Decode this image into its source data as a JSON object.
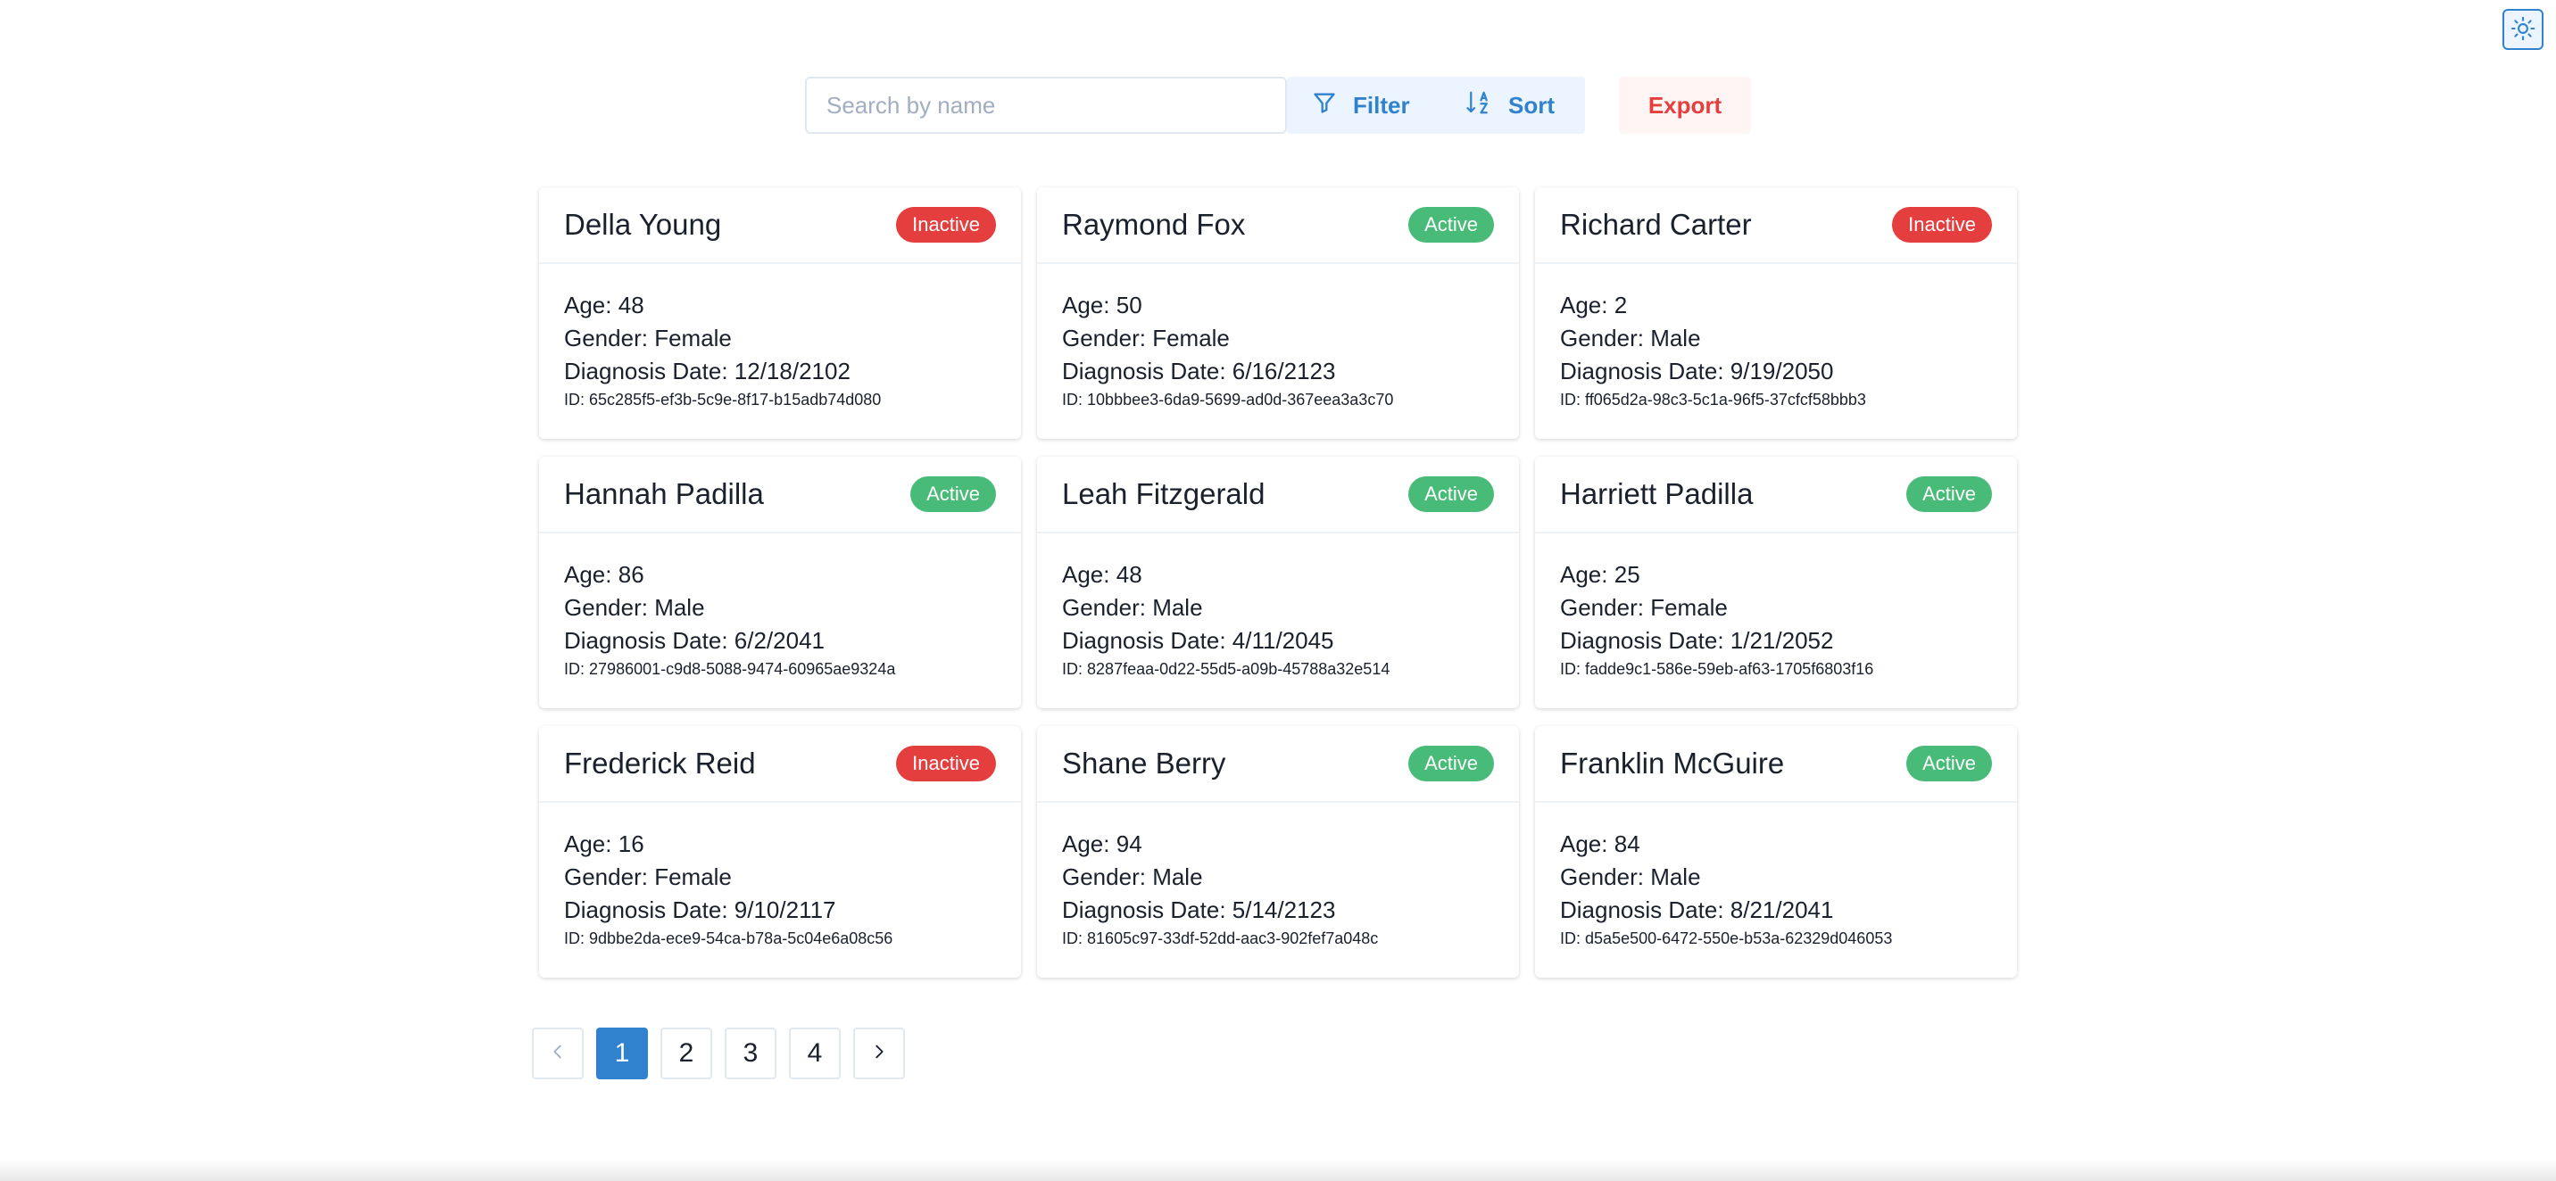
{
  "toolbar": {
    "search_placeholder": "Search by name",
    "filter_label": "Filter",
    "sort_label": "Sort",
    "export_label": "Export"
  },
  "colors": {
    "accent": "#3182ce",
    "active_badge": "#48bb78",
    "inactive_badge": "#e53e3e",
    "export_text": "#e53e3e"
  },
  "labels": {
    "age": "Age:",
    "gender": "Gender:",
    "diagnosis": "Diagnosis Date:",
    "id": "ID:"
  },
  "patients": [
    {
      "name": "Della Young",
      "status": "Inactive",
      "age": "48",
      "gender": "Female",
      "diagnosis_date": "12/18/2102",
      "id": "65c285f5-ef3b-5c9e-8f17-b15adb74d080"
    },
    {
      "name": "Raymond Fox",
      "status": "Active",
      "age": "50",
      "gender": "Female",
      "diagnosis_date": "6/16/2123",
      "id": "10bbbee3-6da9-5699-ad0d-367eea3a3c70"
    },
    {
      "name": "Richard Carter",
      "status": "Inactive",
      "age": "2",
      "gender": "Male",
      "diagnosis_date": "9/19/2050",
      "id": "ff065d2a-98c3-5c1a-96f5-37cfcf58bbb3"
    },
    {
      "name": "Hannah Padilla",
      "status": "Active",
      "age": "86",
      "gender": "Male",
      "diagnosis_date": "6/2/2041",
      "id": "27986001-c9d8-5088-9474-60965ae9324a"
    },
    {
      "name": "Leah Fitzgerald",
      "status": "Active",
      "age": "48",
      "gender": "Male",
      "diagnosis_date": "4/11/2045",
      "id": "8287feaa-0d22-55d5-a09b-45788a32e514"
    },
    {
      "name": "Harriett Padilla",
      "status": "Active",
      "age": "25",
      "gender": "Female",
      "diagnosis_date": "1/21/2052",
      "id": "fadde9c1-586e-59eb-af63-1705f6803f16"
    },
    {
      "name": "Frederick Reid",
      "status": "Inactive",
      "age": "16",
      "gender": "Female",
      "diagnosis_date": "9/10/2117",
      "id": "9dbbe2da-ece9-54ca-b78a-5c04e6a08c56"
    },
    {
      "name": "Shane Berry",
      "status": "Active",
      "age": "94",
      "gender": "Male",
      "diagnosis_date": "5/14/2123",
      "id": "81605c97-33df-52dd-aac3-902fef7a048c"
    },
    {
      "name": "Franklin McGuire",
      "status": "Active",
      "age": "84",
      "gender": "Male",
      "diagnosis_date": "8/21/2041",
      "id": "d5a5e500-6472-550e-b53a-62329d046053"
    }
  ],
  "pagination": {
    "pages": [
      "1",
      "2",
      "3",
      "4"
    ],
    "current": "1"
  }
}
